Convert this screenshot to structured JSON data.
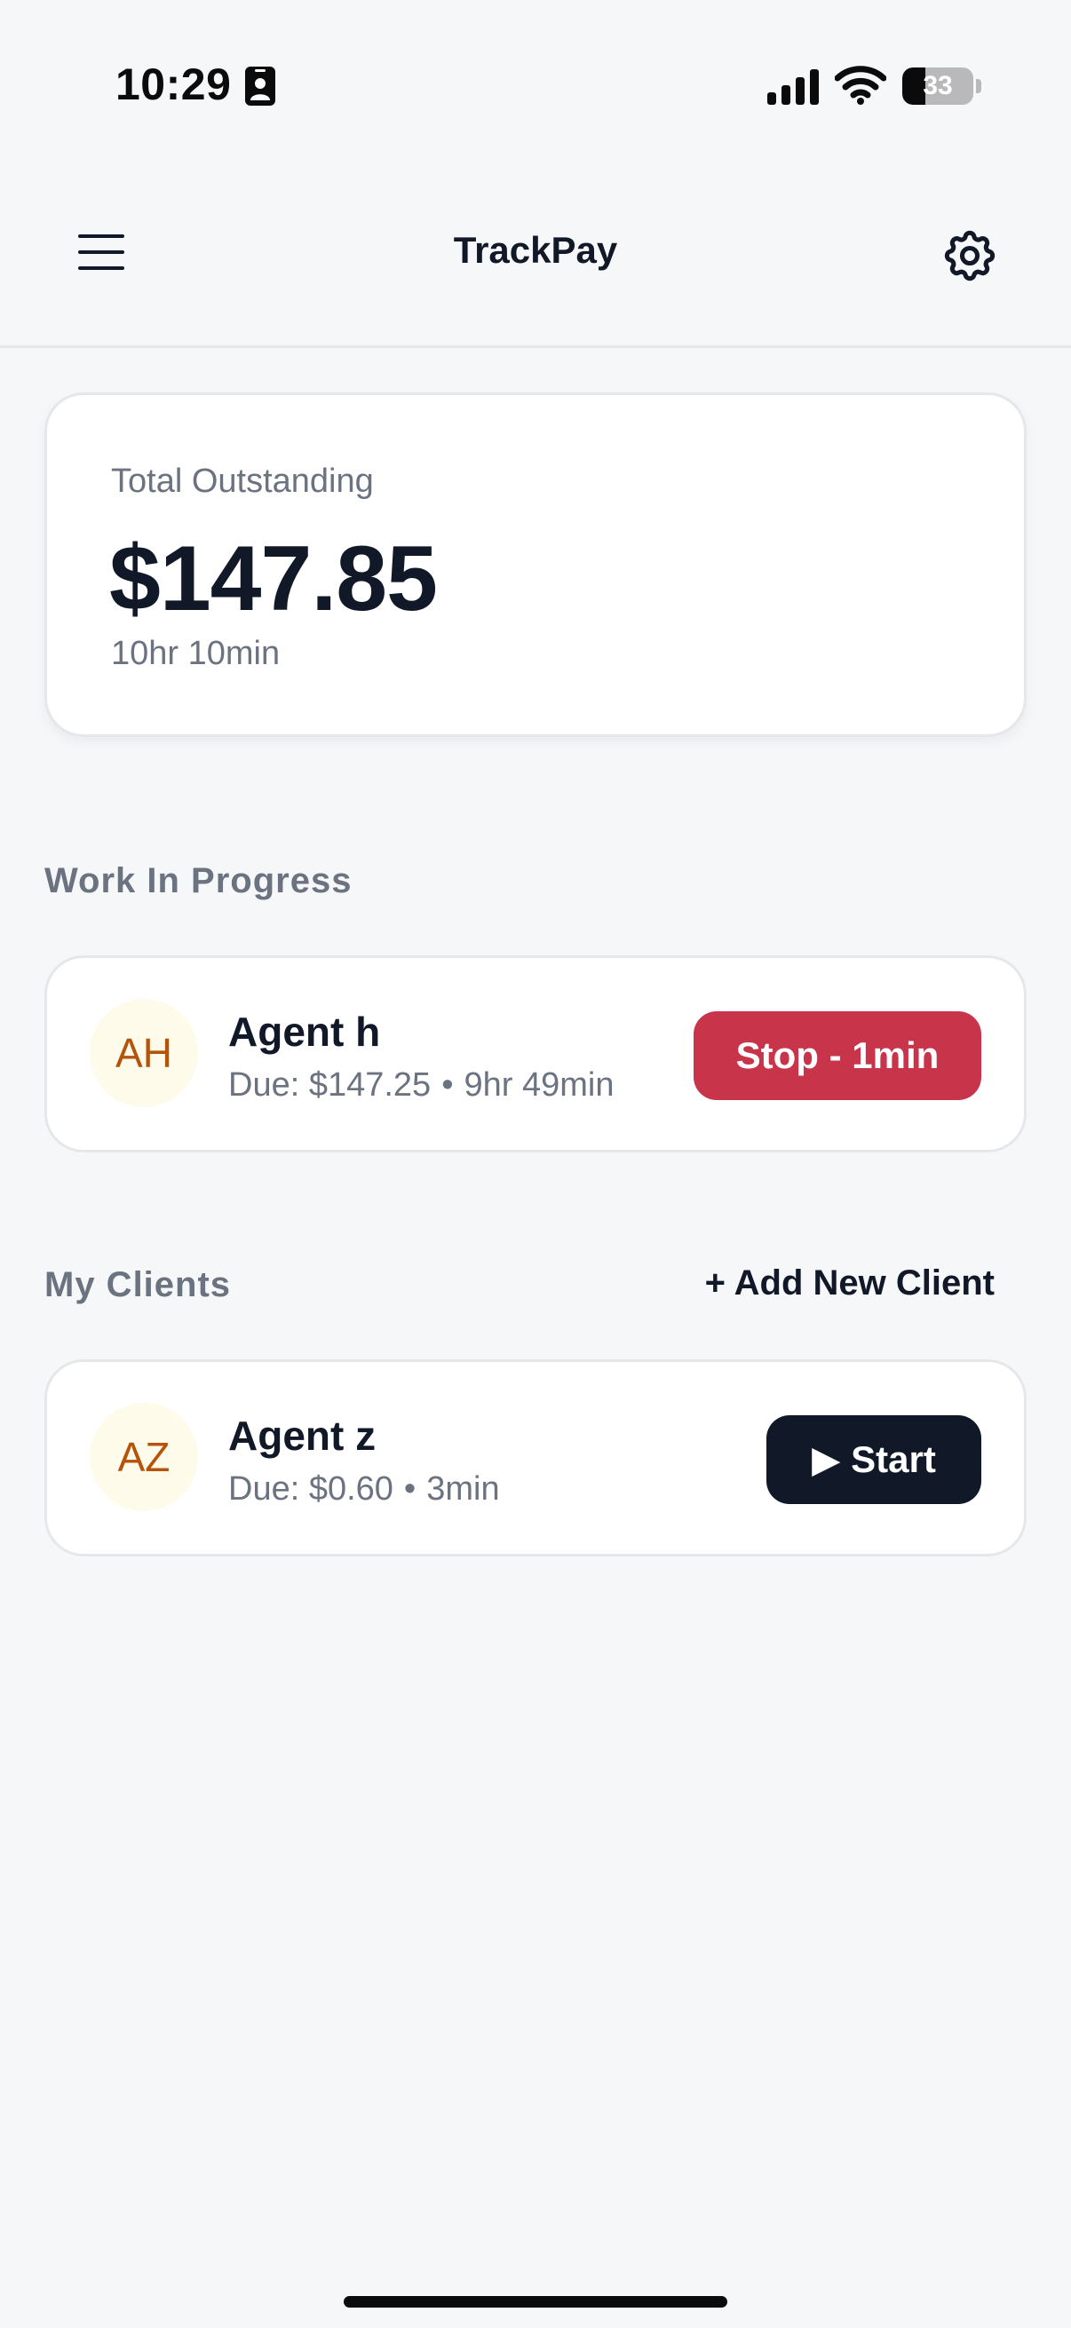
{
  "status_bar": {
    "time": "10:29",
    "battery_level": "33",
    "battery_fraction": 0.33,
    "icons": [
      "id-card-icon",
      "signal-icon",
      "wifi-icon",
      "battery-icon"
    ]
  },
  "header": {
    "title": "TrackPay",
    "menu_icon": "hamburger-menu-icon",
    "settings_icon": "gear-icon"
  },
  "summary": {
    "label": "Total Outstanding",
    "amount": "$147.85",
    "duration": "10hr 10min"
  },
  "work_in_progress": {
    "section_title": "Work In Progress",
    "items": [
      {
        "initials": "AH",
        "name": "Agent h",
        "due": "Due: $147.25",
        "separator": "•",
        "duration": "9hr 49min",
        "action_label": "Stop - 1min"
      }
    ]
  },
  "clients": {
    "section_title": "My Clients",
    "add_label": "+ Add New Client",
    "items": [
      {
        "initials": "AZ",
        "name": "Agent z",
        "due": "Due: $0.60",
        "separator": "•",
        "duration": "3min",
        "action_label": "▶ Start"
      }
    ]
  },
  "colors": {
    "background": "#f6f7f9",
    "primary_text": "#111827",
    "secondary_text": "#6b7280",
    "stop_button": "#c8344a",
    "start_button": "#111827",
    "avatar_bg": "#fffbea",
    "avatar_text": "#b45309"
  }
}
